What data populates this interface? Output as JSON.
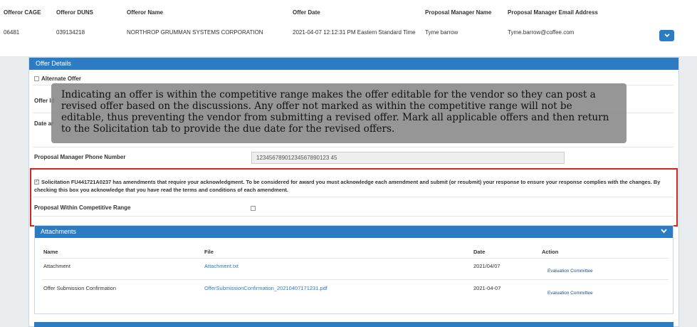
{
  "top_grid": {
    "headers": [
      "Offeror CAGE",
      "Offeror DUNS",
      "Offeror Name",
      "Offer Date",
      "Proposal Manager Name",
      "Proposal Manager Email Address"
    ],
    "row": [
      "06481",
      "039134218",
      "NORTHROP GRUMMAN SYSTEMS CORPORATION",
      "2021-04-07 12:12:31 PM Eastern Standard Time",
      "Tyme barrow",
      "Tyme.barrow@coffee.com"
    ],
    "expand_icon": "chevron-down-icon"
  },
  "offer_details": {
    "title": "Offer Details",
    "alternate_offer_label": "Alternate Offer",
    "offer_id_label_partial": "Offer Id",
    "date_label_partial": "Date ar",
    "phone_label": "Proposal Manager Phone Number",
    "phone_value": "12345678901234567890123 45",
    "ack_text": "Solicitation FU441721A0237 has amendments that require your acknowledgment. To be considered for award you must acknowledge each amendment and submit (or resubmit) your response to ensure your response complies with the changes. By checking this box you acknowledge that you have read the terms and conditions of each amendment.",
    "competitive_range_label": "Proposal Within Competitive Range"
  },
  "attachments": {
    "title": "Attachments",
    "headers": [
      "Name",
      "File",
      "Date",
      "Action"
    ],
    "rows": [
      {
        "name": "Attachment",
        "file": "Attachment.txt",
        "date": "2021/04/07",
        "action": "Evaluation Committee"
      },
      {
        "name": "Offer Submission Confirmation",
        "file": "OfferSubmissionConfirmation_20210407171231.pdf",
        "date": "2021-04-07",
        "action": "Evaluation Committee"
      }
    ]
  },
  "tooltip": {
    "text": "Indicating an offer is within the competitive range makes the offer editable for the vendor so they can post a revised offer based on the discussions. Any offer not marked as within the competitive range will not be editable, thus preventing the vendor from submitting a revised offer. Mark all applicable offers and then return to the Solicitation tab to provide the due date for the revised offers."
  },
  "colors": {
    "accent": "#2c7cc3",
    "highlight_border": "#e0201e"
  }
}
